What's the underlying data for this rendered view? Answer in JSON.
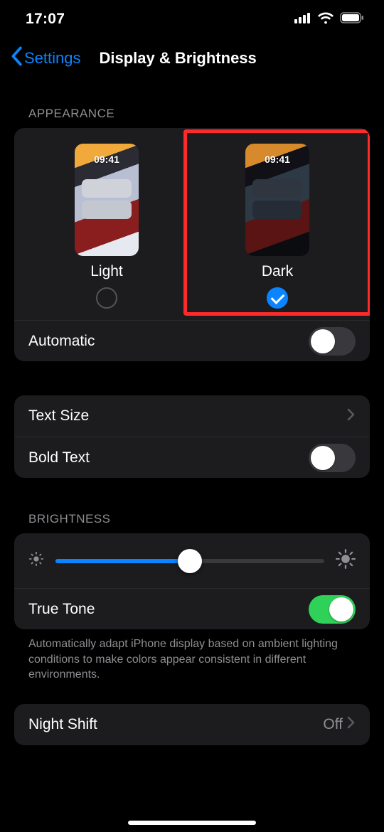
{
  "status": {
    "time": "17:07"
  },
  "nav": {
    "back": "Settings",
    "title": "Display & Brightness"
  },
  "appearance": {
    "header": "APPEARANCE",
    "thumb_time": "09:41",
    "light_label": "Light",
    "dark_label": "Dark",
    "selected": "dark",
    "automatic_label": "Automatic",
    "automatic_on": false
  },
  "text": {
    "size_label": "Text Size",
    "bold_label": "Bold Text",
    "bold_on": false
  },
  "brightness": {
    "header": "BRIGHTNESS",
    "value_pct": 50,
    "truetone_label": "True Tone",
    "truetone_on": true,
    "footer": "Automatically adapt iPhone display based on ambient lighting conditions to make colors appear consistent in different environments."
  },
  "nightshift": {
    "label": "Night Shift",
    "value": "Off"
  }
}
